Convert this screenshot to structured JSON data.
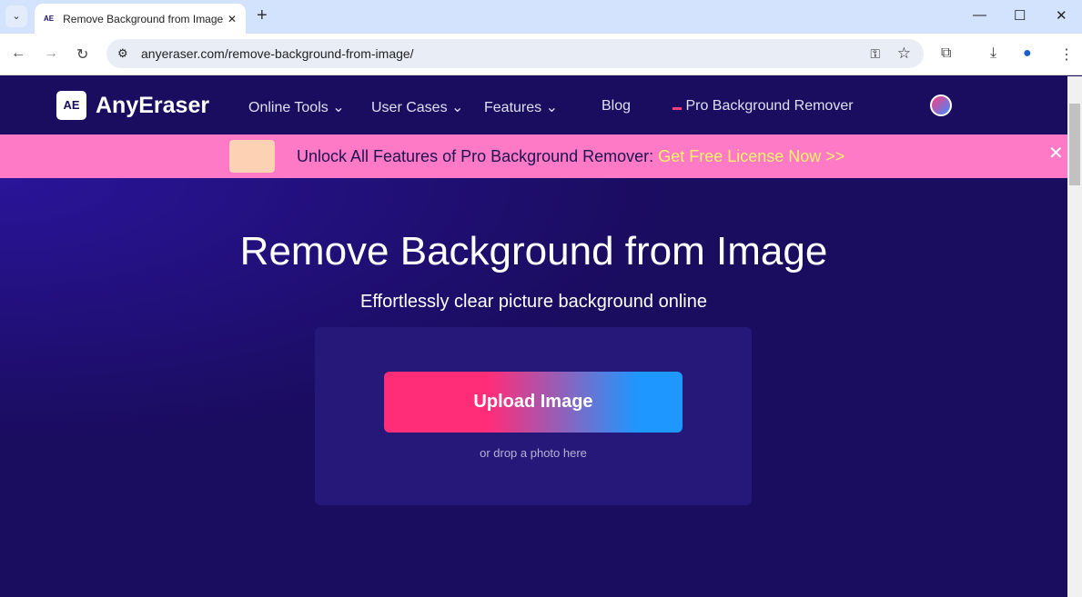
{
  "browser": {
    "tab_title": "Remove Background from Image",
    "favicon": "AE",
    "url": "anyeraser.com/remove-background-from-image/"
  },
  "nav": {
    "logo_mark": "AE",
    "logo": "AnyEraser",
    "items": [
      {
        "label": "Online Tools"
      },
      {
        "label": "User Cases"
      },
      {
        "label": "Features"
      },
      {
        "label": "Blog"
      },
      {
        "label": "Pro Background Remover"
      }
    ]
  },
  "banner": {
    "text": "Unlock All Features of Pro Background Remover:",
    "link": "Get Free License Now >>"
  },
  "hero": {
    "title": "Remove Background from Image",
    "subtitle": "Effortlessly clear picture background online",
    "upload": "Upload Image",
    "drop": "or drop a photo here"
  },
  "colors": {
    "nav_bg": "#1a0c5e",
    "banner_bg": "#ff7ac6",
    "link": "#fff36b",
    "upload_start": "#ff2d78",
    "upload_end": "#1e97ff"
  }
}
